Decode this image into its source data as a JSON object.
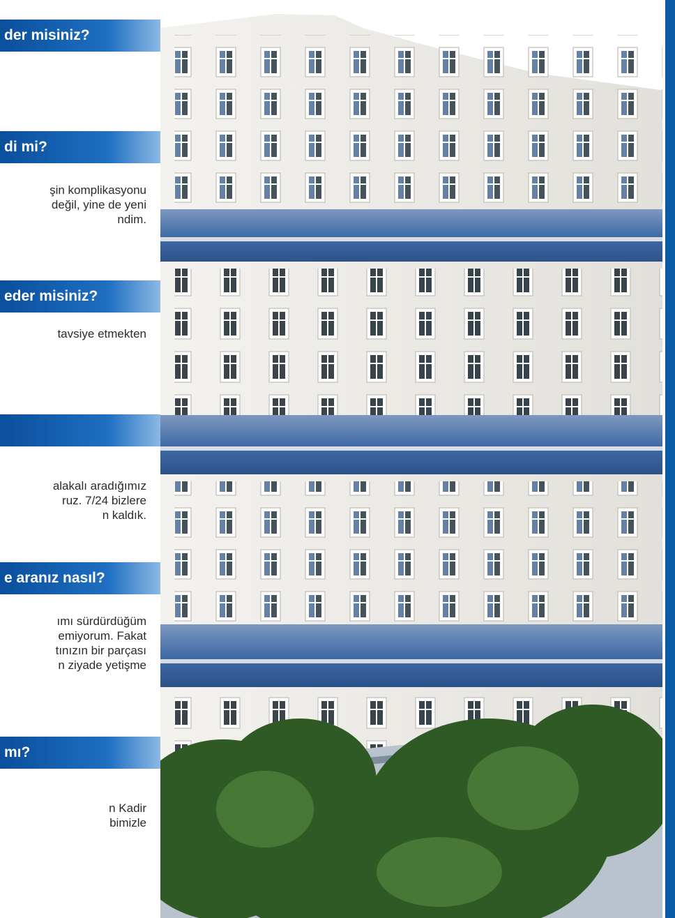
{
  "questions": [
    {
      "heading": "der misiniz?",
      "answer": []
    },
    {
      "heading": "di mi?",
      "answer": [
        "şin komplikasyonu",
        "değil, yine de yeni",
        "ndim."
      ]
    },
    {
      "heading": "eder misiniz?",
      "answer": [
        "tavsiye   etmekten"
      ]
    },
    {
      "heading": "",
      "answer": [
        "alakalı aradığımız",
        "ruz. 7/24 bizlere",
        "n kaldık."
      ]
    },
    {
      "heading": "e aranız nasıl?",
      "answer": [
        "ımı sürdürdüğüm",
        "emiyorum. Fakat",
        "tınızın bir parçası",
        "n ziyade yetişme"
      ]
    },
    {
      "heading": "mı?",
      "answer": [
        "n Kadir",
        "bimizle"
      ]
    }
  ],
  "colors": {
    "accent": "#0a5aa6",
    "bar_start": "#0a4f9c",
    "bar_end": "#9bc2ea"
  },
  "image": {
    "subject": "hospital-building"
  }
}
